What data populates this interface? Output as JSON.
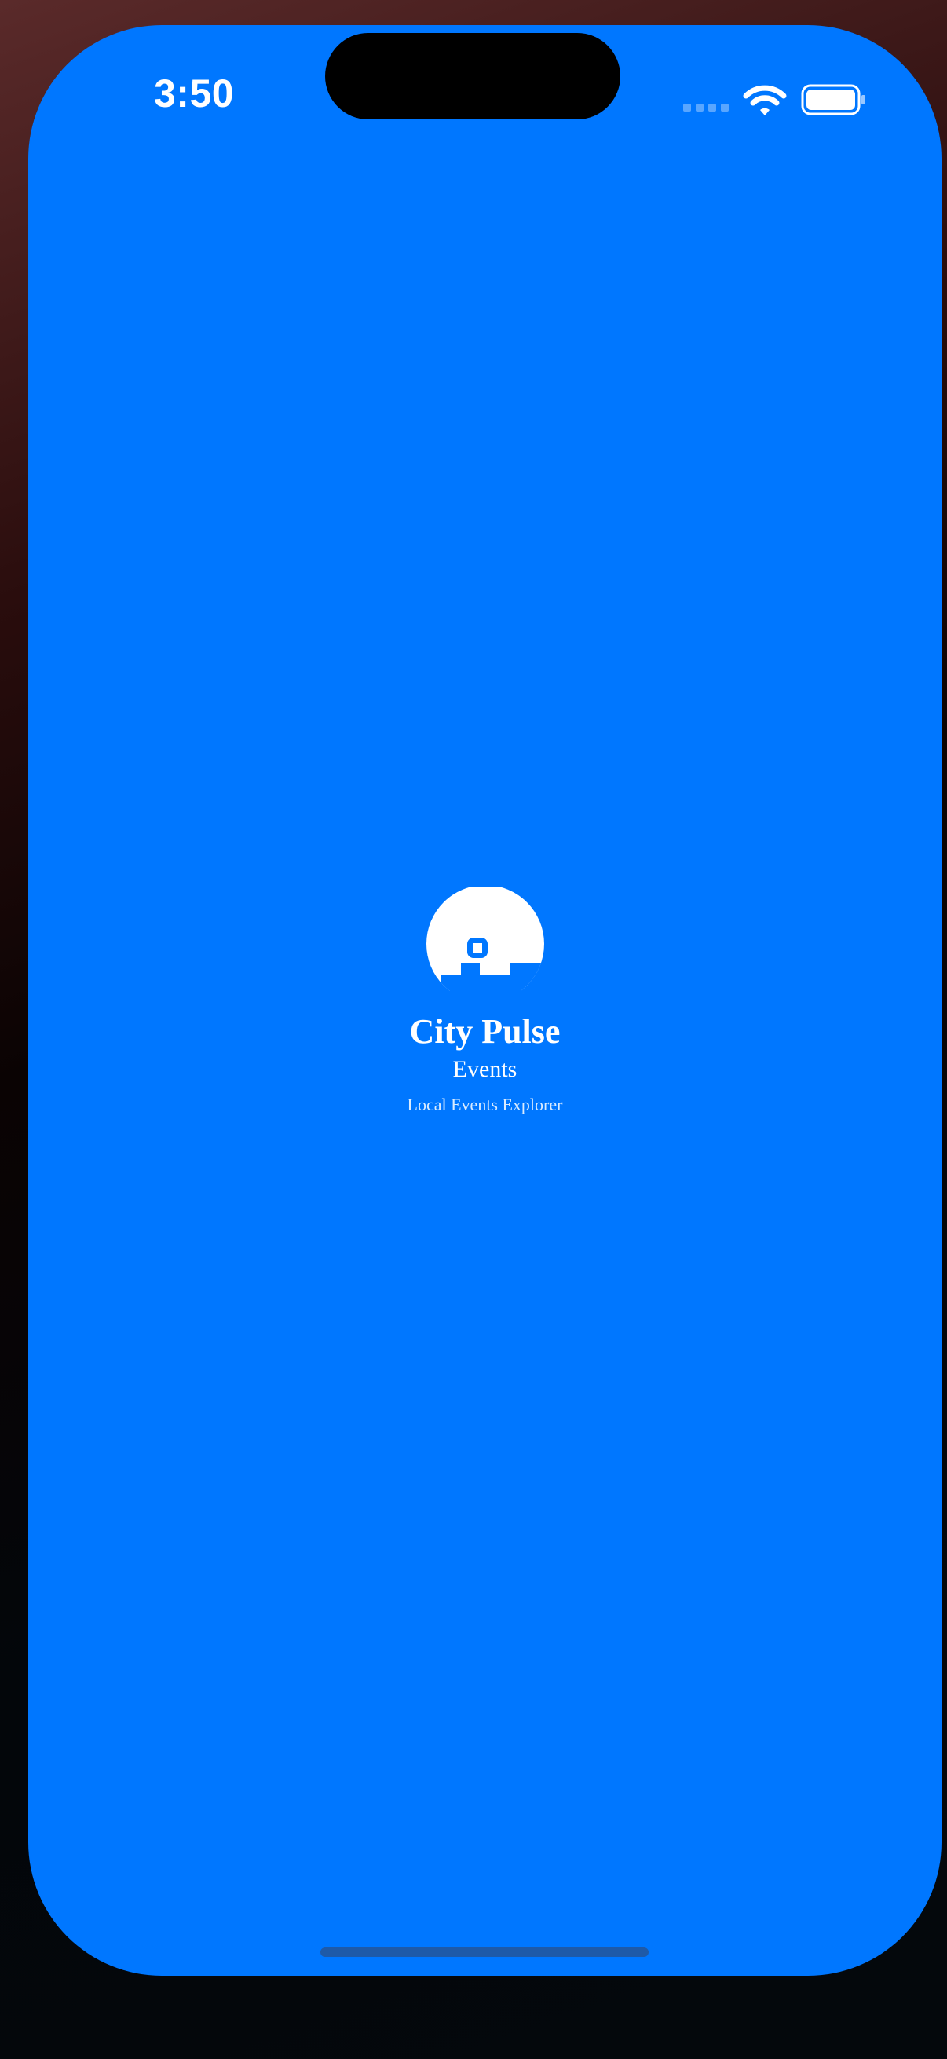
{
  "status_bar": {
    "time": "3:50",
    "signal_icon": "cellular-signal-icon",
    "wifi_icon": "wifi-icon",
    "battery_icon": "battery-icon"
  },
  "splash": {
    "logo_icon": "city-sun-logo-icon",
    "app_name": "City Pulse",
    "subtitle": "Events",
    "tagline": "Local Events Explorer"
  },
  "colors": {
    "background": "#0077FF",
    "foreground": "#FFFFFF"
  }
}
